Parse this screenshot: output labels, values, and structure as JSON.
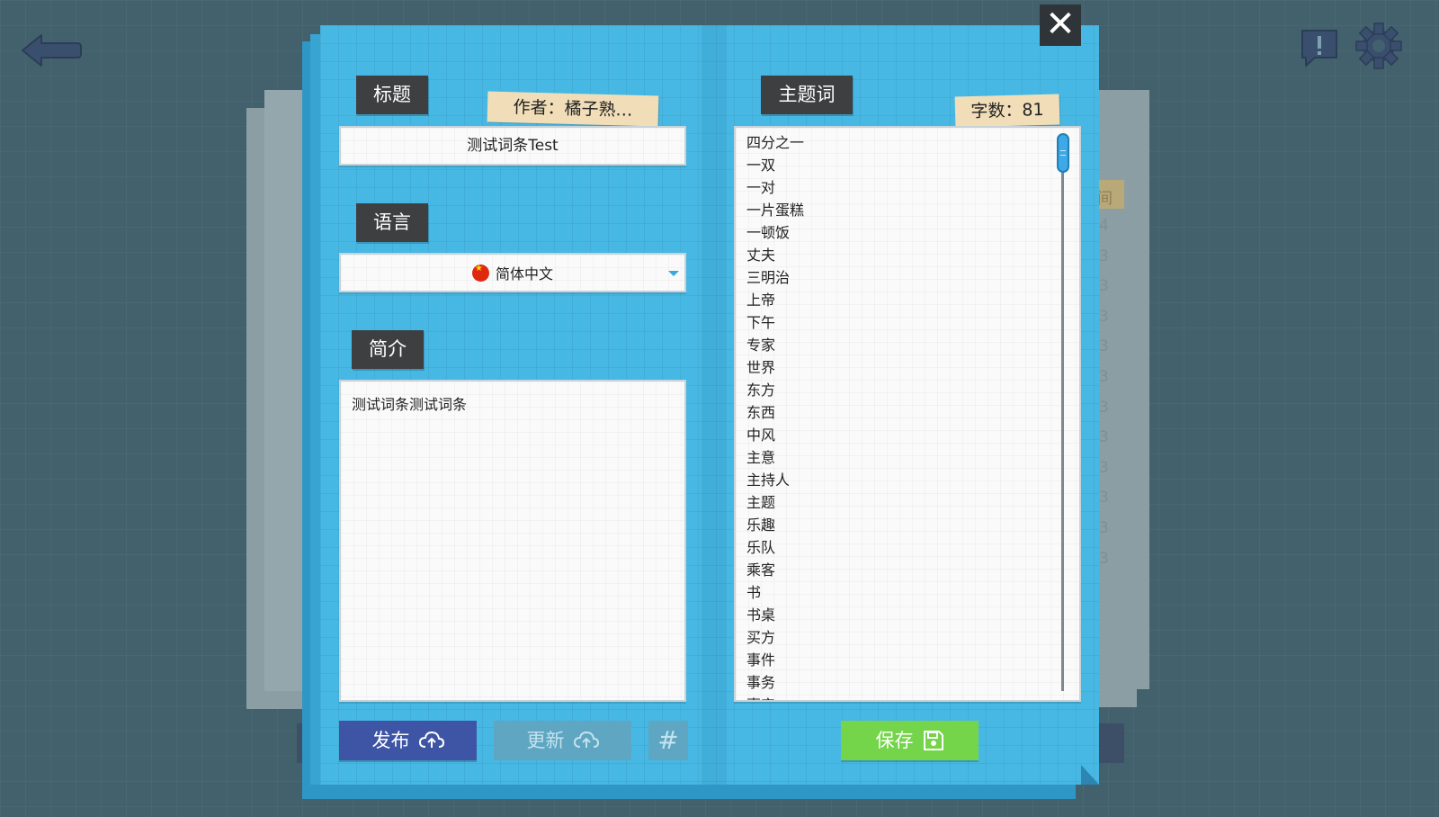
{
  "header": {
    "back_icon": "back-arrow-icon",
    "report_icon": "report-icon",
    "settings_icon": "gear-icon"
  },
  "dialog": {
    "close_label": "✕",
    "title_label": "标题",
    "author_label": "作者：橘子熟…",
    "title_value": "测试词条Test",
    "language_label": "语言",
    "language_value": "简体中文",
    "intro_label": "简介",
    "intro_value": "测试词条测试词条",
    "keywords_label": "主题词",
    "word_count_label": "字数：81",
    "keywords": [
      "四分之一",
      "一双",
      "一对",
      "一片蛋糕",
      "一顿饭",
      "丈夫",
      "三明治",
      "上帝",
      "下午",
      "专家",
      "世界",
      "东方",
      "东西",
      "中风",
      "主意",
      "主持人",
      "主题",
      "乐趣",
      "乐队",
      "乘客",
      "书",
      "书桌",
      "买方",
      "事件",
      "事务",
      "事实"
    ],
    "publish_label": "发布",
    "update_label": "更新",
    "hash_label": "#",
    "save_label": "保存"
  },
  "background": {
    "digits": [
      "4",
      "3",
      "3",
      "3",
      "3",
      "3",
      "3",
      "3",
      "3",
      "3",
      "3",
      "3"
    ],
    "header_char": "间"
  },
  "colors": {
    "panel": "#47b8e3",
    "publish": "#3e55a6",
    "save": "#74d44a",
    "disabled": "#5ea6c2",
    "label": "#3d3f41",
    "paper_tag": "#f1deb8"
  }
}
